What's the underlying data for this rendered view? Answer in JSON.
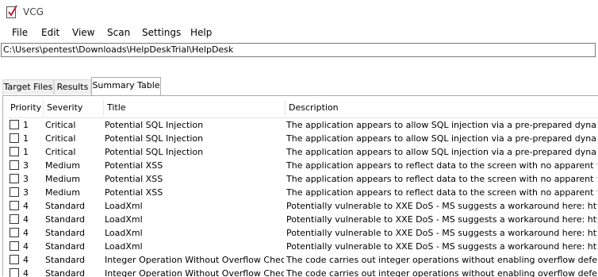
{
  "window": {
    "title": "VCG"
  },
  "menu": [
    "File",
    "Edit",
    "View",
    "Scan",
    "Settings",
    "Help"
  ],
  "target_path": "C:\\Users\\pentest\\Downloads\\HelpDeskTrial\\HelpDesk",
  "tabs": [
    {
      "label": "Target Files",
      "active": false
    },
    {
      "label": "Results",
      "active": false
    },
    {
      "label": "Summary Table",
      "active": true
    }
  ],
  "table": {
    "columns": [
      "Priority",
      "Severity",
      "Title",
      "Description"
    ],
    "rows": [
      {
        "checked": false,
        "priority": "1",
        "severity": "Critical",
        "title": "Potential SQL Injection",
        "description": "The application appears to allow SQL injection via a pre-prepared dynamic SQL ..."
      },
      {
        "checked": false,
        "priority": "1",
        "severity": "Critical",
        "title": "Potential SQL Injection",
        "description": "The application appears to allow SQL injection via a pre-prepared dynamic SQL ..."
      },
      {
        "checked": false,
        "priority": "1",
        "severity": "Critical",
        "title": "Potential SQL Injection",
        "description": "The application appears to allow SQL injection via a pre-prepared dynamic SQL ..."
      },
      {
        "checked": false,
        "priority": "3",
        "severity": "Medium",
        "title": "Potential XSS",
        "description": "The application appears to reflect data to the screen with no apparent validation..."
      },
      {
        "checked": false,
        "priority": "3",
        "severity": "Medium",
        "title": "Potential XSS",
        "description": "The application appears to reflect data to the screen with no apparent validation..."
      },
      {
        "checked": false,
        "priority": "3",
        "severity": "Medium",
        "title": "Potential XSS",
        "description": "The application appears to reflect data to the screen with no apparent validation..."
      },
      {
        "checked": false,
        "priority": "4",
        "severity": "Standard",
        "title": "LoadXml",
        "description": "Potentially vulnerable to XXE DoS - MS suggests a workaround here: http://blo..."
      },
      {
        "checked": false,
        "priority": "4",
        "severity": "Standard",
        "title": "LoadXml",
        "description": "Potentially vulnerable to XXE DoS - MS suggests a workaround here: http://blo..."
      },
      {
        "checked": false,
        "priority": "4",
        "severity": "Standard",
        "title": "LoadXml",
        "description": "Potentially vulnerable to XXE DoS - MS suggests a workaround here: http://blo..."
      },
      {
        "checked": false,
        "priority": "4",
        "severity": "Standard",
        "title": "LoadXml",
        "description": "Potentially vulnerable to XXE DoS - MS suggests a workaround here: http://blo..."
      },
      {
        "checked": false,
        "priority": "4",
        "severity": "Standard",
        "title": "Integer Operation Without Overflow Check",
        "description": "The code carries out integer operations without enabling overflow defences. Ma..."
      },
      {
        "checked": false,
        "priority": "4",
        "severity": "Standard",
        "title": "Integer Operation Without Overflow Check",
        "description": "The code carries out integer operations without enabling overflow defences. Ma..."
      }
    ]
  }
}
